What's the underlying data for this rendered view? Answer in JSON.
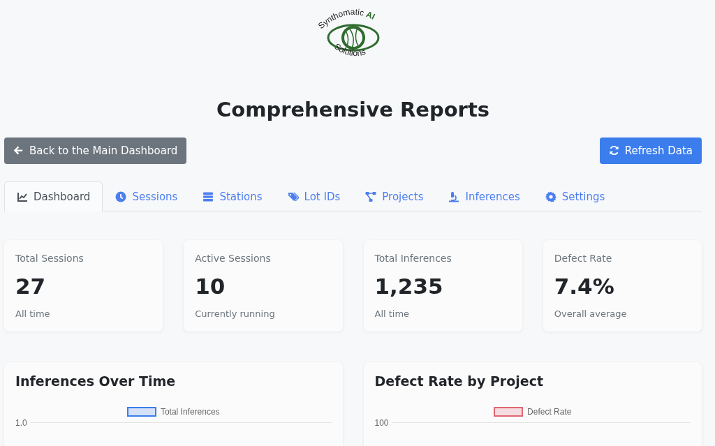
{
  "logo": {
    "top_text": "Synthomatic",
    "accent_text": "AI",
    "bottom_text": "Solutions"
  },
  "title": "Comprehensive Reports",
  "back_button": "Back to the Main Dashboard",
  "refresh_button": "Refresh Data",
  "tabs": [
    {
      "label": "Dashboard",
      "selected": true
    },
    {
      "label": "Sessions",
      "selected": false
    },
    {
      "label": "Stations",
      "selected": false
    },
    {
      "label": "Lot IDs",
      "selected": false
    },
    {
      "label": "Projects",
      "selected": false
    },
    {
      "label": "Inferences",
      "selected": false
    },
    {
      "label": "Settings",
      "selected": false
    }
  ],
  "stats": [
    {
      "label": "Total Sessions",
      "value": "27",
      "note": "All time"
    },
    {
      "label": "Active Sessions",
      "value": "10",
      "note": "Currently running"
    },
    {
      "label": "Total Inferences",
      "value": "1,235",
      "note": "All time"
    },
    {
      "label": "Defect Rate",
      "value": "7.4%",
      "note": "Overall average"
    }
  ],
  "charts": [
    {
      "title": "Inferences Over Time",
      "legend": "Total Inferences",
      "color": "#3b7ded",
      "top_tick": "1.0"
    },
    {
      "title": "Defect Rate by Project",
      "legend": "Defect Rate",
      "color": "#e06672",
      "top_tick": "100"
    }
  ]
}
